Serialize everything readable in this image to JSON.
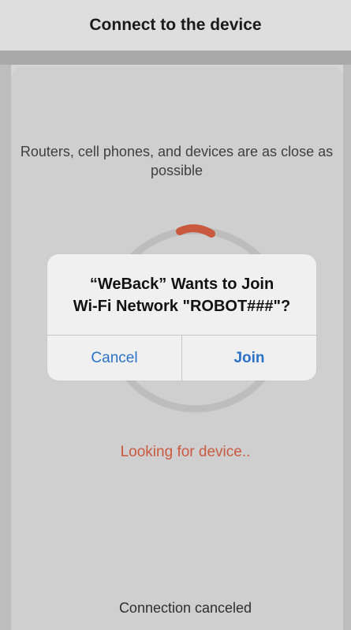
{
  "header": {
    "title": "Connect to the device"
  },
  "main": {
    "hint": "Routers, cell phones, and devices are as close as possible",
    "status": "Looking for device..",
    "footer": "Connection canceled"
  },
  "alert": {
    "title_line1": "“WeBack” Wants to Join",
    "title_line2": "Wi-Fi Network \"ROBOT###\"?",
    "cancel_label": "Cancel",
    "join_label": "Join"
  },
  "colors": {
    "accent": "#2a73c9",
    "progress": "#c95a40",
    "ring": "#bdbdbd"
  }
}
